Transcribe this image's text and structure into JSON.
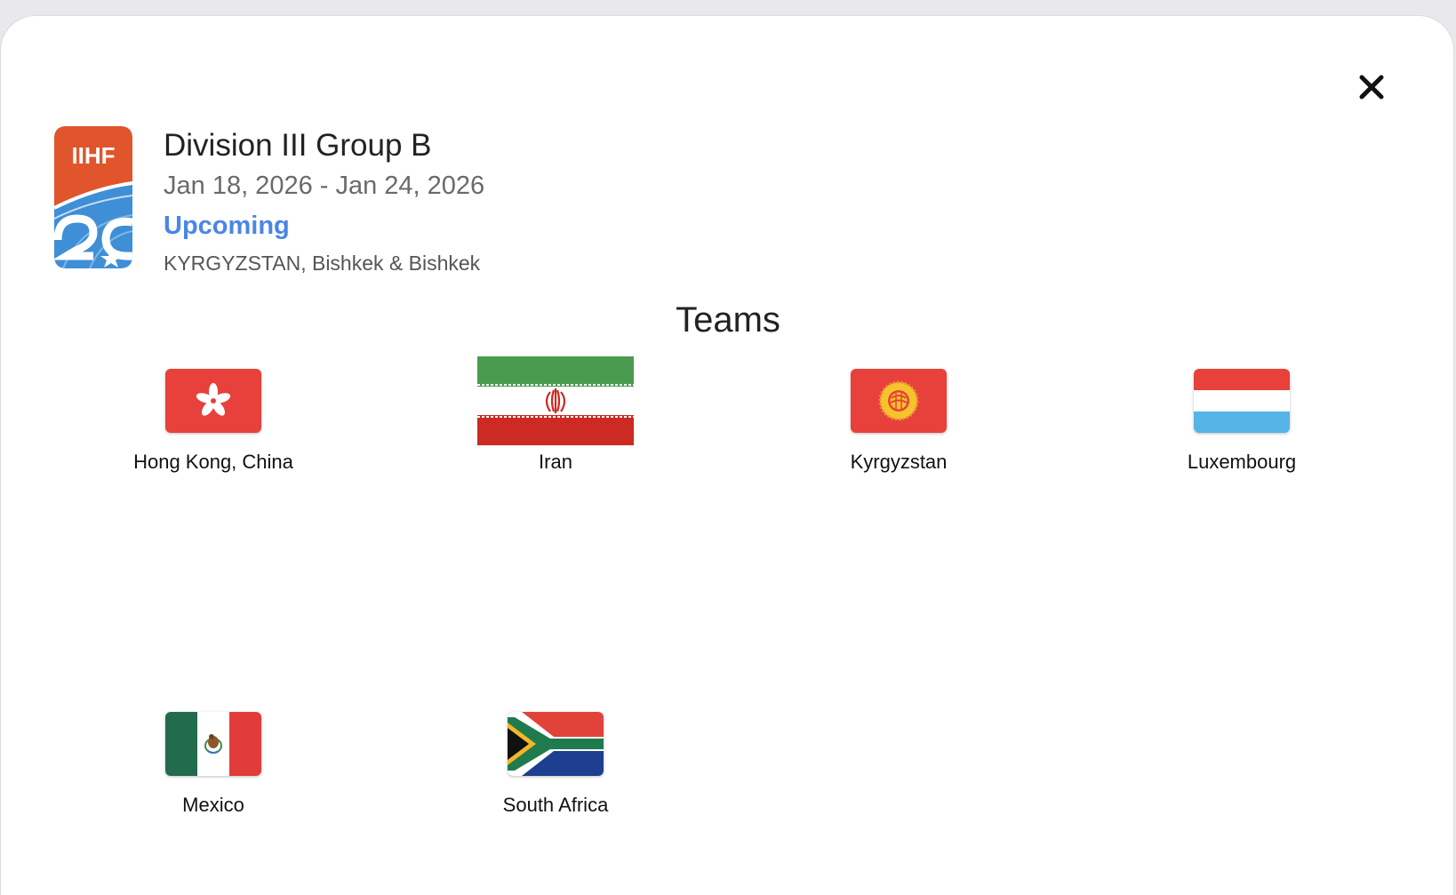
{
  "event": {
    "logo_text": "IIHF",
    "title": "Division III Group B",
    "dates": "Jan 18, 2026 - Jan 24, 2026",
    "status": "Upcoming",
    "location": "KYRGYZSTAN, Bishkek & Bishkek"
  },
  "teams_section": {
    "title": "Teams",
    "teams": [
      {
        "name": "Hong Kong, China",
        "flag": "hong-kong-flag-icon"
      },
      {
        "name": "Iran",
        "flag": "iran-flag-icon"
      },
      {
        "name": "Kyrgyzstan",
        "flag": "kyrgyzstan-flag-icon"
      },
      {
        "name": "Luxembourg",
        "flag": "luxembourg-flag-icon"
      },
      {
        "name": "Mexico",
        "flag": "mexico-flag-icon"
      },
      {
        "name": "South Africa",
        "flag": "south-africa-flag-icon"
      }
    ]
  },
  "icons": {
    "close": "close-icon"
  },
  "colors": {
    "status": "#4a86e8",
    "logo_orange": "#e0552b",
    "logo_blue": "#3f8fd6"
  }
}
